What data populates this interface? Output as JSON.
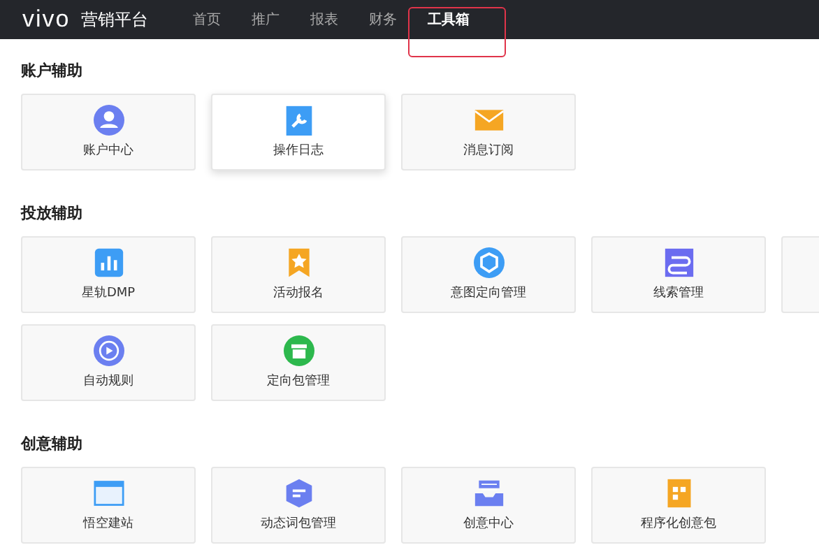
{
  "header": {
    "logo": "vivo",
    "title": "营销平台",
    "nav": [
      {
        "label": "首页",
        "selected": false
      },
      {
        "label": "推广",
        "selected": false
      },
      {
        "label": "报表",
        "selected": false
      },
      {
        "label": "财务",
        "selected": false
      },
      {
        "label": "工具箱",
        "selected": true
      }
    ],
    "annotation": {
      "kind": "frame",
      "color": "#e0344a"
    }
  },
  "sections": [
    {
      "title": "账户辅助",
      "rows": [
        [
          {
            "kind": "avatar",
            "label": "账户中心",
            "selected": false
          },
          {
            "kind": "wrench",
            "label": "操作日志",
            "selected": true
          },
          {
            "kind": "mail",
            "label": "消息订阅",
            "selected": false
          }
        ]
      ]
    },
    {
      "title": "投放辅助",
      "rows": [
        [
          {
            "kind": "bars",
            "label": "星轨DMP",
            "selected": false
          },
          {
            "kind": "ribbon",
            "label": "活动报名",
            "selected": false
          },
          {
            "kind": "cube",
            "label": "意图定向管理",
            "selected": false
          },
          {
            "kind": "route",
            "label": "线索管理",
            "selected": false
          },
          {
            "kind": "blank",
            "selected": false
          }
        ],
        [
          {
            "kind": "cycle",
            "label": "自动规则",
            "selected": false
          },
          {
            "kind": "box",
            "label": "定向包管理",
            "selected": false
          }
        ]
      ]
    },
    {
      "title": "创意辅助",
      "rows": [
        [
          {
            "kind": "browser",
            "label": "悟空建站",
            "selected": false
          },
          {
            "kind": "hexagon",
            "label": "动态词包管理",
            "selected": false
          },
          {
            "kind": "tray",
            "label": "创意中心",
            "selected": false
          },
          {
            "kind": "grid",
            "label": "程序化创意包",
            "selected": false
          }
        ]
      ]
    }
  ]
}
